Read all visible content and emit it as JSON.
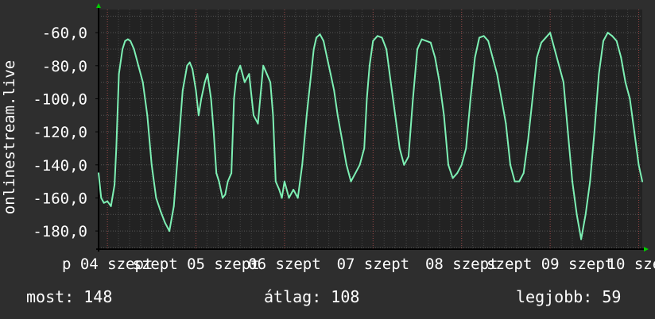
{
  "chart_data": {
    "type": "line",
    "ylabel": "onlinestream.live",
    "ylim": [
      -191,
      -46
    ],
    "yticks": [
      -60,
      -80,
      -100,
      -120,
      -140,
      -160,
      -180
    ],
    "ytick_labels": [
      "-60,0",
      "-80,0",
      "-100,0",
      "-120,0",
      "-140,0",
      "-160,0",
      "-180,0"
    ],
    "xlim": [
      3.9,
      10.04
    ],
    "xticks": [
      {
        "x": 4.0,
        "label": "p 04 szept"
      },
      {
        "x": 5.0,
        "label": "szept 05 szept"
      },
      {
        "x": 6.0,
        "label": "06 szept"
      },
      {
        "x": 7.0,
        "label": "07 szept"
      },
      {
        "x": 8.0,
        "label": "08 szept"
      },
      {
        "x": 9.0,
        "label": "szept 09 szept"
      },
      {
        "x": 10.0,
        "label": "10 szep"
      }
    ],
    "grid": true,
    "background_color": "#222222",
    "axis_color": "#000000",
    "grid_color": "#555555",
    "line_color": "#7df0b4",
    "arrow_color": "#00cc00",
    "series": [
      {
        "x": [
          3.9,
          3.93,
          3.96,
          4.0,
          4.04,
          4.08,
          4.1,
          4.13,
          4.17,
          4.2,
          4.23,
          4.26,
          4.3,
          4.35,
          4.4,
          4.45,
          4.5,
          4.55,
          4.6,
          4.65,
          4.7,
          4.75,
          4.8,
          4.85,
          4.9,
          4.93,
          4.96,
          5.0,
          5.03,
          5.06,
          5.1,
          5.13,
          5.17,
          5.2,
          5.23,
          5.26,
          5.3,
          5.33,
          5.36,
          5.4,
          5.43,
          5.46,
          5.5,
          5.55,
          5.6,
          5.65,
          5.7,
          5.73,
          5.76,
          5.8,
          5.84,
          5.87,
          5.9,
          5.94,
          5.97,
          6.0,
          6.05,
          6.1,
          6.15,
          6.2,
          6.25,
          6.3,
          6.33,
          6.36,
          6.4,
          6.44,
          6.48,
          6.52,
          6.56,
          6.6,
          6.65,
          6.7,
          6.75,
          6.8,
          6.85,
          6.9,
          6.93,
          6.96,
          7.0,
          7.05,
          7.1,
          7.15,
          7.2,
          7.25,
          7.3,
          7.35,
          7.4,
          7.45,
          7.5,
          7.55,
          7.6,
          7.65,
          7.7,
          7.75,
          7.8,
          7.85,
          7.9,
          7.95,
          8.0,
          8.05,
          8.1,
          8.15,
          8.2,
          8.25,
          8.3,
          8.35,
          8.4,
          8.45,
          8.5,
          8.55,
          8.6,
          8.65,
          8.7,
          8.75,
          8.8,
          8.85,
          8.9,
          8.95,
          9.0,
          9.05,
          9.1,
          9.15,
          9.2,
          9.25,
          9.3,
          9.35,
          9.4,
          9.45,
          9.5,
          9.55,
          9.6,
          9.65,
          9.7,
          9.75,
          9.8,
          9.85,
          9.9,
          9.95,
          10.0,
          10.04
        ],
        "y": [
          -145,
          -160,
          -163,
          -162,
          -165,
          -152,
          -130,
          -85,
          -70,
          -65,
          -64,
          -65,
          -70,
          -80,
          -90,
          -110,
          -140,
          -160,
          -168,
          -175,
          -180,
          -165,
          -130,
          -95,
          -80,
          -78,
          -82,
          -95,
          -110,
          -100,
          -90,
          -85,
          -100,
          -120,
          -145,
          -150,
          -160,
          -158,
          -150,
          -145,
          -100,
          -85,
          -80,
          -90,
          -85,
          -110,
          -115,
          -97,
          -80,
          -85,
          -90,
          -110,
          -150,
          -155,
          -160,
          -150,
          -160,
          -155,
          -160,
          -140,
          -110,
          -85,
          -70,
          -63,
          -61,
          -65,
          -75,
          -85,
          -95,
          -110,
          -125,
          -140,
          -150,
          -145,
          -140,
          -130,
          -100,
          -80,
          -65,
          -62,
          -63,
          -70,
          -90,
          -110,
          -130,
          -140,
          -135,
          -100,
          -70,
          -64,
          -65,
          -66,
          -75,
          -90,
          -110,
          -140,
          -148,
          -145,
          -140,
          -130,
          -100,
          -75,
          -63,
          -62,
          -65,
          -75,
          -85,
          -100,
          -115,
          -140,
          -150,
          -150,
          -145,
          -125,
          -100,
          -75,
          -66,
          -63,
          -60,
          -70,
          -80,
          -90,
          -120,
          -150,
          -170,
          -185,
          -170,
          -150,
          -120,
          -85,
          -65,
          -60,
          -62,
          -65,
          -75,
          -90,
          -100,
          -120,
          -140,
          -150
        ]
      }
    ]
  },
  "stats": {
    "most": "most: 148",
    "avg": "átlag: 108",
    "best": "legjobb: 59"
  }
}
